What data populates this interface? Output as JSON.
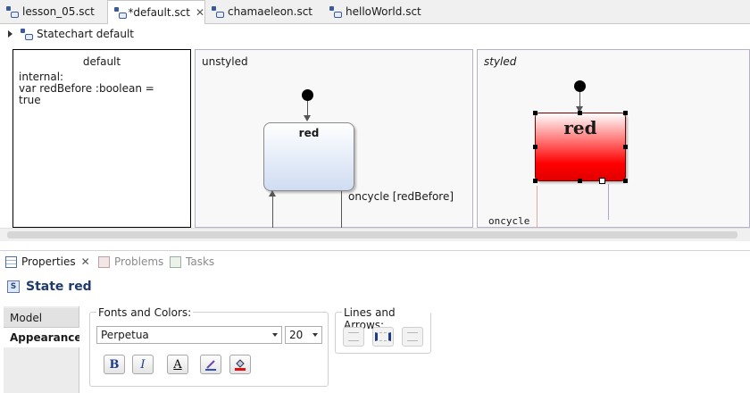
{
  "editor_tabs": [
    {
      "label": "lesson_05.sct",
      "icon": "statechart-file-icon"
    },
    {
      "label": "*default.sct",
      "icon": "statechart-file-icon",
      "active": true
    },
    {
      "label": "chamaeleon.sct",
      "icon": "statechart-file-icon"
    },
    {
      "label": "helloWorld.sct",
      "icon": "statechart-file-icon"
    }
  ],
  "breadcrumb": {
    "label": "Statechart default"
  },
  "diagram": {
    "definition": {
      "title": "default",
      "body": "internal:\nvar redBefore :boolean =\ntrue"
    },
    "regions": [
      {
        "label": "unstyled",
        "state": "red",
        "transition_label": "oncycle [redBefore]"
      },
      {
        "label": "styled",
        "state": "red",
        "transition_label": "oncycle"
      }
    ],
    "styled_fill_colors": [
      "#ffffff",
      "#ff0000"
    ]
  },
  "views": {
    "tabs": [
      {
        "label": "Properties",
        "icon": "properties-icon",
        "active": true
      },
      {
        "label": "Problems",
        "icon": "problems-icon"
      },
      {
        "label": "Tasks",
        "icon": "tasks-icon"
      }
    ]
  },
  "properties": {
    "badge": "S",
    "title": "State red",
    "side_tabs": [
      "Model",
      "Appearance"
    ],
    "fonts_group": {
      "label": "Fonts and Colors:",
      "font": "Perpetua",
      "size": "20",
      "buttons": [
        "B",
        "I",
        "A"
      ]
    },
    "lines_group": {
      "label": "Lines and Arrows:"
    }
  }
}
